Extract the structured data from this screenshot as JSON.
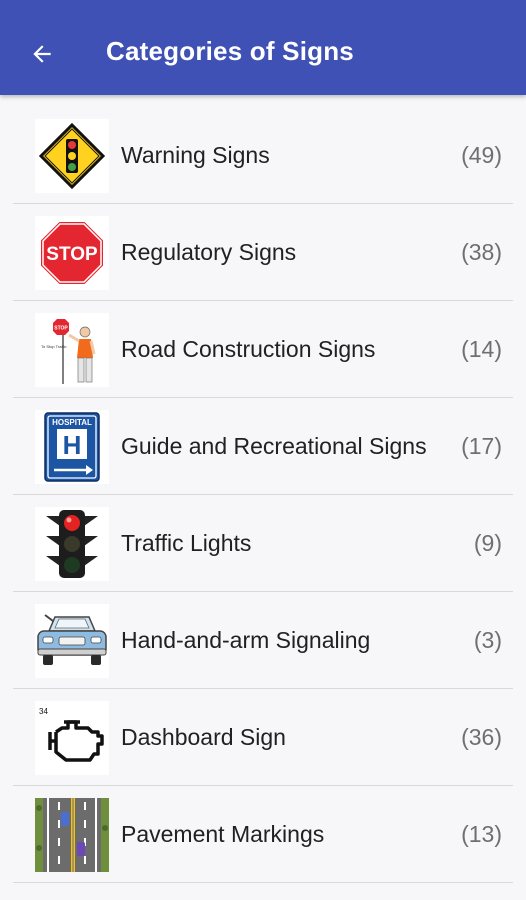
{
  "appbar": {
    "title": "Categories of Signs",
    "back_icon": "arrow-back-icon",
    "color": "#3f51b5"
  },
  "categories": [
    {
      "label": "Warning Signs",
      "count": "(49)",
      "icon": "warning-sign-icon"
    },
    {
      "label": "Regulatory Signs",
      "count": "(38)",
      "icon": "stop-sign-icon"
    },
    {
      "label": "Road Construction Signs",
      "count": "(14)",
      "icon": "flagger-icon"
    },
    {
      "label": "Guide and Recreational Signs",
      "count": "(17)",
      "icon": "hospital-sign-icon"
    },
    {
      "label": "Traffic Lights",
      "count": "(9)",
      "icon": "traffic-light-icon"
    },
    {
      "label": "Hand-and-arm Signaling",
      "count": "(3)",
      "icon": "car-icon"
    },
    {
      "label": "Dashboard Sign",
      "count": "(36)",
      "icon": "engine-icon"
    },
    {
      "label": "Pavement Markings",
      "count": "(13)",
      "icon": "road-markings-icon"
    }
  ],
  "thumb_text": {
    "stop": "STOP",
    "hospital": "HOSPITAL",
    "hospital_letter": "H",
    "flagger_sign": "STOP",
    "flagger_caption": "To Stop Traffic",
    "dashboard_number": "34"
  }
}
